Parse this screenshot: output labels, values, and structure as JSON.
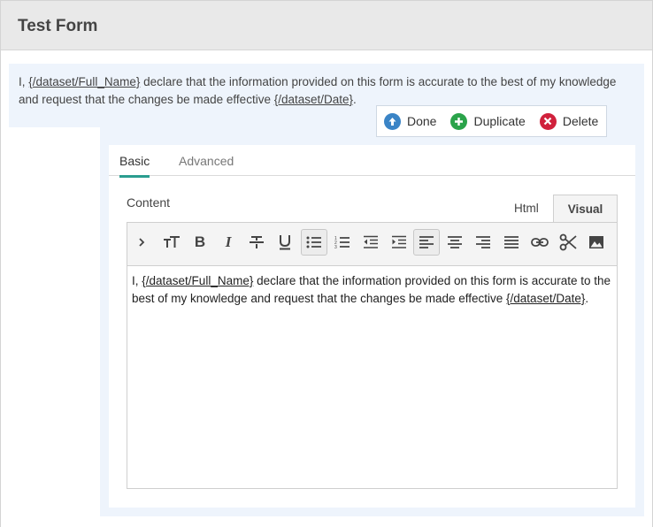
{
  "header": {
    "title": "Test Form"
  },
  "preview": {
    "text_1": "I, ",
    "var_1": "{/dataset/Full_Name}",
    "text_2": " declare that the information provided on this form is accurate to the best of my knowledge and request that the changes be made effective ",
    "var_2": "{/dataset/Date}",
    "text_3": "."
  },
  "actions": {
    "done_label": "Done",
    "duplicate_label": "Duplicate",
    "delete_label": "Delete"
  },
  "tabs": {
    "basic": "Basic",
    "advanced": "Advanced"
  },
  "content": {
    "label": "Content",
    "html_tab": "Html",
    "visual_tab": "Visual",
    "text_1": "I, ",
    "var_1": "{/dataset/Full_Name}",
    "text_2": " declare that the information provided on this form is accurate to the best of my knowledge and request that the changes be made effective ",
    "var_2": "{/dataset/Date}",
    "text_3": "."
  },
  "toolbar": {
    "buttons": [
      "chevron-right-icon",
      "text-size-icon",
      "bold-icon",
      "italic-icon",
      "strikethrough-icon",
      "underline-icon",
      "bulleted-list-icon",
      "numbered-list-icon",
      "outdent-icon",
      "indent-icon",
      "align-left-icon",
      "align-center-icon",
      "align-right-icon",
      "justify-icon",
      "link-icon",
      "cut-icon",
      "image-icon"
    ],
    "active": [
      "bulleted-list-icon",
      "align-left-icon"
    ]
  },
  "colors": {
    "accent": "#2a9d8f",
    "done": "#3a84c6",
    "duplicate": "#2aa34a",
    "delete": "#d0213c",
    "panel_bg": "#eef4fc"
  }
}
